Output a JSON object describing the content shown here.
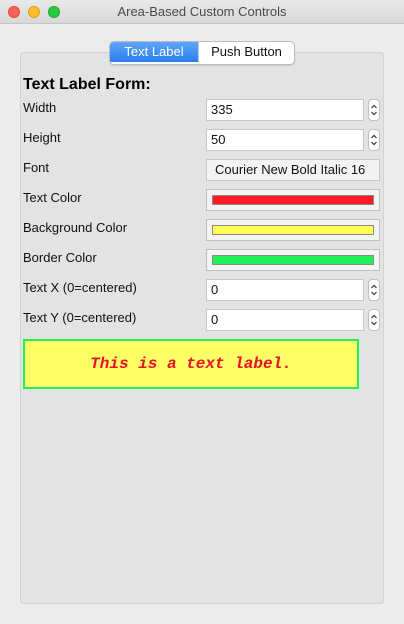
{
  "window": {
    "title": "Area-Based Custom Controls"
  },
  "tabs": {
    "items": [
      {
        "label": "Text Label",
        "selected": true
      },
      {
        "label": "Push Button",
        "selected": false
      }
    ]
  },
  "form": {
    "heading": "Text Label Form:",
    "width": {
      "label": "Width",
      "value": "335"
    },
    "height": {
      "label": "Height",
      "value": "50"
    },
    "font": {
      "label": "Font",
      "value": "Courier New Bold Italic 16"
    },
    "text_color": {
      "label": "Text Color",
      "color": "#ff1a24"
    },
    "background_color": {
      "label": "Background Color",
      "color": "#ffff55"
    },
    "border_color": {
      "label": "Border Color",
      "color": "#22f05a"
    },
    "text_x": {
      "label": "Text X (0=centered)",
      "value": "0"
    },
    "text_y": {
      "label": "Text Y (0=centered)",
      "value": "0"
    }
  },
  "preview": {
    "text": "This is a text label.",
    "text_color": "#e8102a",
    "background_color": "#ffff66",
    "border_color": "#22f05a"
  },
  "icons": {
    "stepper": "up-down-chevron-icon",
    "close": "close-window-icon",
    "minimize": "minimize-window-icon",
    "maximize": "zoom-window-icon"
  }
}
